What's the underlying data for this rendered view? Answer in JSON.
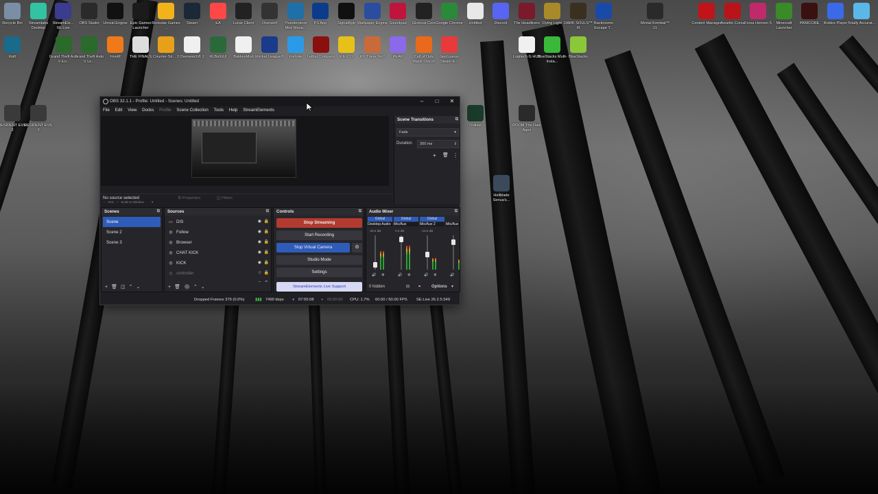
{
  "desktop_icons_row1": [
    {
      "label": "Recycle Bin",
      "color": "#7a8fa6"
    },
    {
      "label": "Streamlabs Desktop",
      "color": "#31c3a2"
    },
    {
      "label": "StreamEle... SE.Live",
      "color": "#3b3b8f"
    },
    {
      "label": "OBS Studio",
      "color": "#2a2a2a"
    },
    {
      "label": "Unreal Engine",
      "color": "#111111"
    },
    {
      "label": "Epic Games Launcher",
      "color": "#1b1b1b"
    },
    {
      "label": "Rockstar Games ...",
      "color": "#f2b21a"
    },
    {
      "label": "Steam",
      "color": "#1b2838"
    },
    {
      "label": "EA",
      "color": "#ff4747"
    },
    {
      "label": "Lunar Client",
      "color": "#222222"
    },
    {
      "label": "Overwolf",
      "color": "#333333"
    },
    {
      "label": "Thunderstore Mod Mana...",
      "color": "#1f6fa8"
    },
    {
      "label": "PS App",
      "color": "#0b3c8c"
    },
    {
      "label": "SignalRgb",
      "color": "#101010"
    },
    {
      "label": "Wallpaper Engine",
      "color": "#2a4da0"
    },
    {
      "label": "Soundpad",
      "color": "#c0143c"
    },
    {
      "label": "Glorious Core",
      "color": "#222222"
    },
    {
      "label": "Google Chrome",
      "color": "#2a8a3a"
    },
    {
      "label": "Untitled",
      "color": "#e8e8e8"
    },
    {
      "label": "Discord",
      "color": "#5865f2"
    },
    {
      "label": "The Headliners",
      "color": "#7a1a2a"
    },
    {
      "label": "Dying Light",
      "color": "#a88a2a"
    },
    {
      "label": "DARK SOULS™ III",
      "color": "#3a3020"
    },
    {
      "label": "Backrooms Escape T...",
      "color": "#1a4aa8"
    },
    {
      "label": "Mortal Kombat™ 11",
      "color": "#2a2a2a"
    },
    {
      "label": "Content Manager",
      "color": "#c0141a"
    },
    {
      "label": "Assetto Corsa",
      "color": "#b8141a"
    },
    {
      "label": "Forza Horizon 5",
      "color": "#c02a6a"
    },
    {
      "label": "Minecraft Launcher",
      "color": "#3a8a2a"
    },
    {
      "label": "PANICORE",
      "color": "#3a1010"
    },
    {
      "label": "Roblox Player",
      "color": "#3a6ae8"
    },
    {
      "label": "Totally Accurat...",
      "color": "#5ab8e8"
    }
  ],
  "desktop_icons_row2": [
    {
      "label": "Raft",
      "color": "#1a6a8a"
    },
    {
      "label": "Grand Theft Auto V En...",
      "color": "#2a6a2a"
    },
    {
      "label": "Grand Theft Auto V Le...",
      "color": "#2a6a2a"
    },
    {
      "label": "FiveM",
      "color": "#f07a1a"
    },
    {
      "label": "THE FINALS",
      "color": "#dddddd"
    },
    {
      "label": "Counter-Str... 2",
      "color": "#e8a01a"
    },
    {
      "label": "Overwatch® 2",
      "color": "#f0f0f0"
    },
    {
      "label": "RLBotGUI",
      "color": "#2a6a3a"
    },
    {
      "label": "BakkesMod",
      "color": "#f0f0f0"
    },
    {
      "label": "Rocket League®",
      "color": "#1a3a8a"
    },
    {
      "label": "Fortnite",
      "color": "#2a9ae8"
    },
    {
      "label": "Lethal Company",
      "color": "#8a1010"
    },
    {
      "label": "R.E.P.O.",
      "color": "#e8c01a"
    },
    {
      "label": "RV There Yet?",
      "color": "#c86a3a"
    },
    {
      "label": "PEAK",
      "color": "#8a6ae8"
    },
    {
      "label": "Call of Duty Black Ops III",
      "color": "#e86a1a"
    },
    {
      "label": "GeoGuessr Steam E...",
      "color": "#e83a3a"
    },
    {
      "label": "Logitech G HUB",
      "color": "#f0f0f0"
    },
    {
      "label": "BlueStacks Multi-Insta...",
      "color": "#3ab83a"
    },
    {
      "label": "BlueStacks",
      "color": "#8ac83a"
    }
  ],
  "desktop_icons_col": [
    {
      "label": "RESIDENT EVIL 2",
      "color": "#3a3a3a"
    },
    {
      "label": "RESIDENT EVIL 3",
      "color": "#3a3a3a"
    }
  ],
  "desktop_icons_misc": [
    {
      "label": "Outlast",
      "color": "#1a3a2a"
    },
    {
      "label": "DOOM The Dark Ages",
      "color": "#2a2a2a"
    },
    {
      "label": "Hellblade Senua's...",
      "color": "#3a4a5a"
    }
  ],
  "obs": {
    "title": "OBS 32.1.1 - Profile: Untitled - Scenes: Untitled",
    "menu": [
      "File",
      "Edit",
      "View",
      "Docks",
      "Profile",
      "Scene Collection",
      "Tools",
      "Help",
      "StreamElements"
    ],
    "zoom": "11%",
    "scale_label": "Scale to Window",
    "no_source": "No source selected",
    "properties": "Properties",
    "filters": "Filters",
    "scene_transitions": {
      "title": "Scene Transitions",
      "transition": "Fade",
      "duration_label": "Duration",
      "duration": "300 ms"
    },
    "scenes": {
      "title": "Scenes",
      "items": [
        "Scene",
        "Scene 2",
        "Scene 3"
      ]
    },
    "sources": {
      "title": "Sources",
      "items": [
        "DIS",
        "Follow",
        "Browser",
        "CHAT KICK",
        "KICK",
        "controller",
        "chat"
      ]
    },
    "controls": {
      "title": "Controls",
      "stop_streaming": "Stop Streaming",
      "start_recording": "Start Recording",
      "stop_virtual_camera": "Stop Virtual Camera",
      "studio_mode": "Studio Mode",
      "settings": "Settings",
      "se_support": "StreamElements Live Support"
    },
    "audio_mixer": {
      "title": "Audio Mixer",
      "channels": [
        {
          "name": "Desktop Audio",
          "tag": "Global",
          "db": "-38.6 dB"
        },
        {
          "name": "Mic/Aux",
          "tag": "Global",
          "db": "0.0 dB"
        },
        {
          "name": "Mic/Aux 2",
          "tag": "Global",
          "db": "-16.6 dB"
        },
        {
          "name": "Mic/Aux",
          "tag": "",
          "db": ""
        }
      ],
      "hidden": "0 hidden",
      "options": "Options"
    },
    "status": {
      "dropped": "Dropped Frames 379 (0.0%)",
      "bitrate": "7490 kbps",
      "live_time": "07:55:08",
      "rec_time": "00:00:00",
      "cpu": "CPU: 1.7%",
      "fps": "60.00 / 60.00 FPS",
      "se": "SE.Live 26.2.5.549"
    }
  }
}
